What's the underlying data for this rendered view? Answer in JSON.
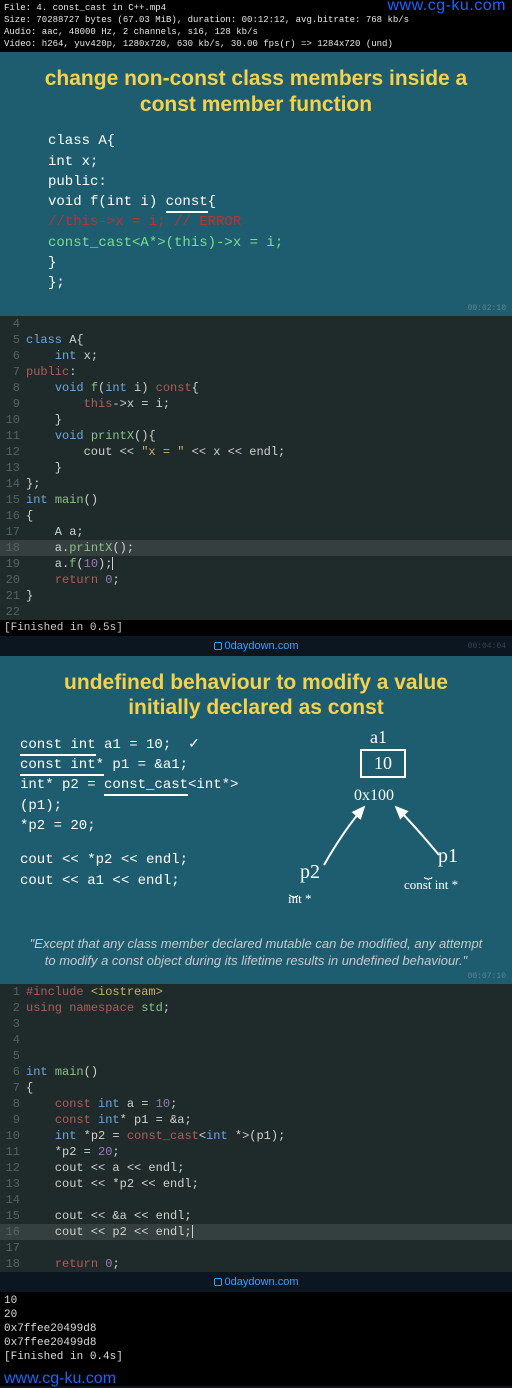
{
  "fileinfo": {
    "line1": "File: 4. const_cast in C++.mp4",
    "line2": "Size: 70288727 bytes (67.03 MiB), duration: 00:12:12, avg.bitrate: 768 kb/s",
    "line3": "Audio: aac, 48000 Hz, 2 channels, s16, 128 kb/s",
    "line4": "Video: h264, yuv420p, 1280x720, 630 kb/s, 30.00 fps(r) => 1284x720 (und)",
    "watermark": "www.cg-ku.com"
  },
  "slide1": {
    "title_l1": "change non-const class members inside a",
    "title_l2": "const member function",
    "code": {
      "l1": "class A{",
      "l2": "    int x;",
      "l3": "public:",
      "l4_a": "    void f(int i) ",
      "l4_const": "const",
      "l4_b": "{",
      "l5_red": "        //this->x = i; // ERROR",
      "l6_a": "        ",
      "l6_grn": "const_cast<A*>(this)->x = i;",
      "l7": "    }",
      "l8": "};"
    },
    "timestamp": "00:02:10"
  },
  "separator": {
    "label": "0daydown.com",
    "ts_upper": "00:04:04"
  },
  "editor1": {
    "lines": [
      {
        "n": "4",
        "html": ""
      },
      {
        "n": "5",
        "html": "<span class='type'>class</span> A{"
      },
      {
        "n": "6",
        "html": "    <span class='type'>int</span> x;"
      },
      {
        "n": "7",
        "html": "<span class='kw'>public</span>:"
      },
      {
        "n": "8",
        "html": "    <span class='type'>void</span> <span class='fn'>f</span>(<span class='type'>int</span> i) <span class='const'>const</span>{"
      },
      {
        "n": "9",
        "html": "        <span class='kw'>this</span>-&gt;x = i;"
      },
      {
        "n": "10",
        "html": "    }"
      },
      {
        "n": "11",
        "html": "    <span class='type'>void</span> <span class='fn'>printX</span>(){"
      },
      {
        "n": "12",
        "html": "        cout &lt;&lt; <span class='str'>\"x = \"</span> &lt;&lt; x &lt;&lt; endl;"
      },
      {
        "n": "13",
        "html": "    }"
      },
      {
        "n": "14",
        "html": "};"
      },
      {
        "n": "15",
        "html": "<span class='type'>int</span> <span class='fn'>main</span>()"
      },
      {
        "n": "16",
        "html": "{"
      },
      {
        "n": "17",
        "html": "    A a;"
      },
      {
        "n": "18",
        "html": "    a.<span class='fn'>printX</span>();",
        "hl": true
      },
      {
        "n": "19",
        "html": "    a.<span class='fn'>f</span>(<span class='num'>10</span>);<span class='cur'></span>"
      },
      {
        "n": "20",
        "html": "    <span class='ret'>return</span> <span class='num'>0</span>;"
      },
      {
        "n": "21",
        "html": "}"
      },
      {
        "n": "22",
        "html": ""
      }
    ],
    "finished": "[Finished in 0.5s]"
  },
  "slide2": {
    "title_l1": "undefined behaviour to modify a value",
    "title_l2": "initially declared as const",
    "code": {
      "l1_a": "const int",
      "l1_b": " a1 = 10;",
      "l2_a": "const int*",
      "l2_b": " p1 = &a1;",
      "l3_a": "int* p2 = ",
      "l3_b": "const_cast",
      "l3_c": "<int*>(p1);",
      "l4": "*p2 = 20;",
      "blank": "",
      "l5": "cout << *p2 << endl;",
      "l6": "cout << a1 << endl;"
    },
    "annot": {
      "a1": "a1",
      "box": "10",
      "addr": "0x100",
      "p1": "p1",
      "p2": "p2",
      "t_intstar": "int *",
      "t_constintstar": "const int *"
    },
    "quote": "\"Except that any class member declared mutable can be modified, any attempt to modify a const object during its lifetime results in undefined behaviour.\"",
    "timestamp": "00:07:10"
  },
  "editor2": {
    "lines": [
      {
        "n": "1",
        "html": "<span class='pp'>#include</span> <span class='inc'>&lt;iostream&gt;</span>"
      },
      {
        "n": "2",
        "html": "<span class='kw'>using</span> <span class='kw'>namespace</span> <span class='ns'>std</span>;"
      },
      {
        "n": "3",
        "html": ""
      },
      {
        "n": "4",
        "html": ""
      },
      {
        "n": "5",
        "html": ""
      },
      {
        "n": "6",
        "html": "<span class='type'>int</span> <span class='fn'>main</span>()"
      },
      {
        "n": "7",
        "html": "{"
      },
      {
        "n": "8",
        "html": "    <span class='const'>const</span> <span class='type'>int</span> a = <span class='num'>10</span>;"
      },
      {
        "n": "9",
        "html": "    <span class='const'>const</span> <span class='type'>int</span>* p1 = &amp;a;"
      },
      {
        "n": "10",
        "html": "    <span class='type'>int</span> *p2 = <span class='kw'>const_cast</span>&lt;<span class='type'>int</span> *&gt;(p1);"
      },
      {
        "n": "11",
        "html": "    *p2 = <span class='num'>20</span>;"
      },
      {
        "n": "12",
        "html": "    cout &lt;&lt; a &lt;&lt; endl;"
      },
      {
        "n": "13",
        "html": "    cout &lt;&lt; *p2 &lt;&lt; endl;"
      },
      {
        "n": "14",
        "html": ""
      },
      {
        "n": "15",
        "html": "    cout &lt;&lt; &amp;a &lt;&lt; endl;"
      },
      {
        "n": "16",
        "html": "    cout &lt;&lt; p2 &lt;&lt; endl;<span class='cur'></span>",
        "hl": true
      },
      {
        "n": "17",
        "html": ""
      },
      {
        "n": "18",
        "html": "    <span class='ret'>return</span> <span class='num'>0</span>;"
      }
    ]
  },
  "term": {
    "l1": "10",
    "l2": "20",
    "l3": "0x7ffee20499d8",
    "l4": "0x7ffee20499d8",
    "l5": "[Finished in 0.4s]",
    "watermark": "www.cg-ku.com"
  }
}
